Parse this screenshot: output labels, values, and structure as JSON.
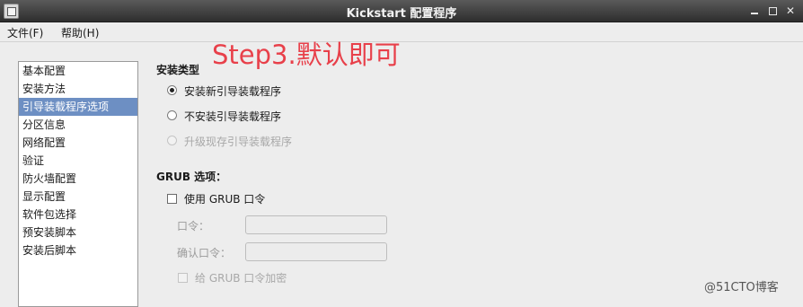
{
  "window": {
    "title": "Kickstart 配置程序",
    "icons": {
      "app": "app-icon",
      "minimize": "minimize-icon",
      "maximize": "maximize-icon",
      "close": "close-icon"
    },
    "close_glyph": "✕"
  },
  "menubar": {
    "file": "文件(F)",
    "help": "帮助(H)"
  },
  "annotation": "Step3.默认即可",
  "sidebar": {
    "items": [
      {
        "label": "基本配置"
      },
      {
        "label": "安装方法"
      },
      {
        "label": "引导装载程序选项",
        "selected": true
      },
      {
        "label": "分区信息"
      },
      {
        "label": "网络配置"
      },
      {
        "label": "验证"
      },
      {
        "label": "防火墙配置"
      },
      {
        "label": "显示配置"
      },
      {
        "label": "软件包选择"
      },
      {
        "label": "预安装脚本"
      },
      {
        "label": "安装后脚本"
      }
    ]
  },
  "install_type": {
    "title": "安装类型",
    "options": [
      {
        "label": "安装新引导装载程序",
        "checked": true,
        "enabled": true
      },
      {
        "label": "不安装引导装载程序",
        "checked": false,
        "enabled": true
      },
      {
        "label": "升级现存引导装载程序",
        "checked": false,
        "enabled": false
      }
    ]
  },
  "grub": {
    "title": "GRUB 选项：",
    "use_password_label": "使用 GRUB 口令",
    "use_password_checked": false,
    "password_label": "口令：",
    "password_value": "",
    "confirm_label": "确认口令：",
    "confirm_value": "",
    "encrypt_label": "给 GRUB 口令加密",
    "encrypt_checked": false,
    "encrypt_enabled": false
  },
  "watermark": "@51CTO博客",
  "colors": {
    "selection": "#6d8fc3",
    "annotation": "#e8404a",
    "titlebar": "#3a3a3a"
  }
}
